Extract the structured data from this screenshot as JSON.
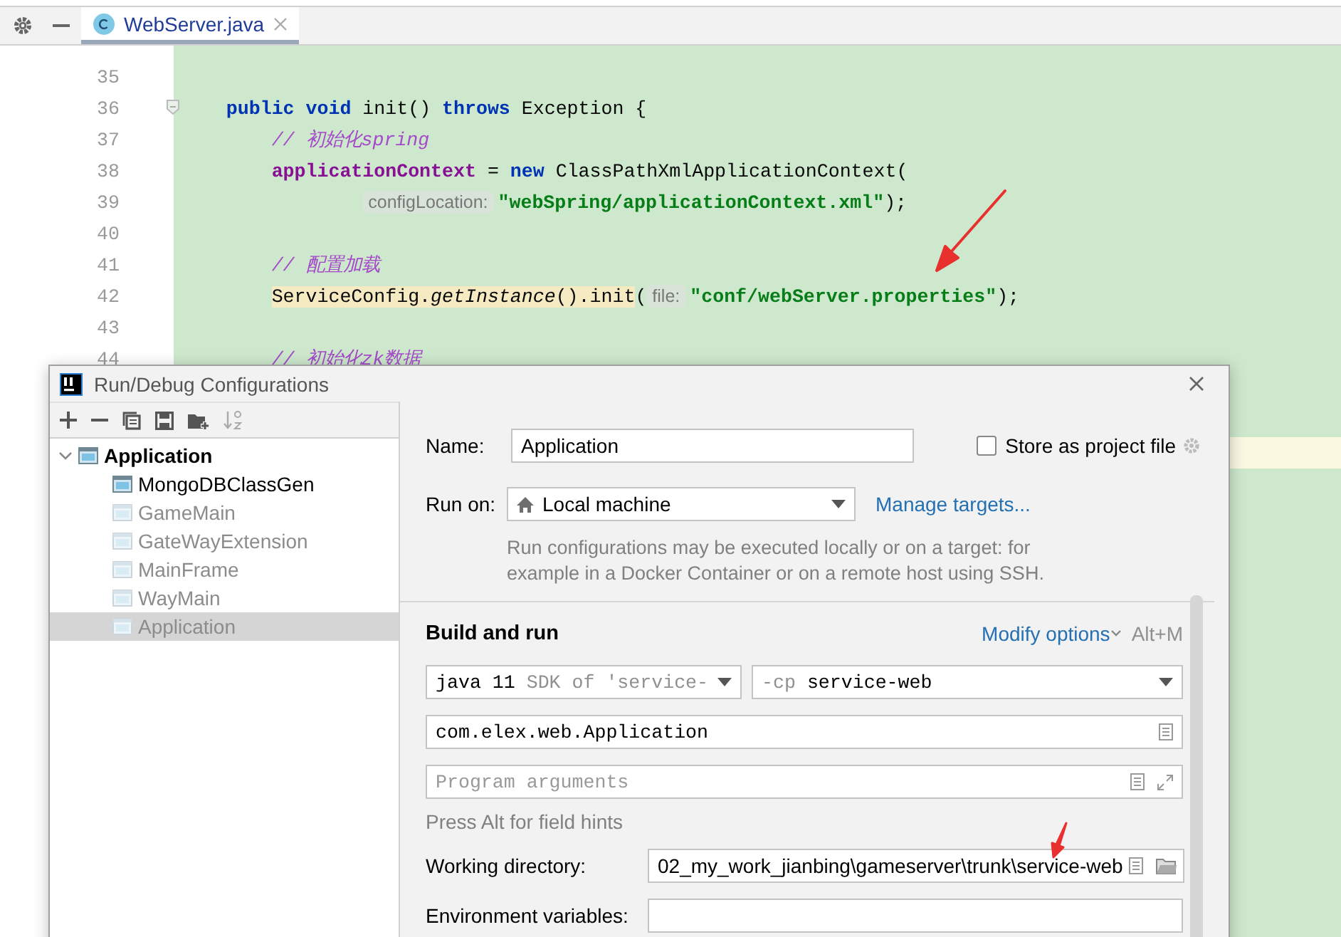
{
  "editor": {
    "tab": {
      "title": "WebServer.java",
      "selected": true
    },
    "lines": [
      {
        "number": "35"
      },
      {
        "number": "36",
        "fold": true,
        "kind": "method",
        "tokens": [
          {
            "kind": "keyword",
            "text": "public "
          },
          {
            "kind": "keyword",
            "text": "void "
          },
          {
            "kind": "plain",
            "text": "init() "
          },
          {
            "kind": "keyword",
            "text": "throws "
          },
          {
            "kind": "plain",
            "text": "Exception {"
          }
        ]
      },
      {
        "number": "37",
        "kind": "statement",
        "tokens": [
          {
            "kind": "comment",
            "text": "// 初始化spring"
          }
        ]
      },
      {
        "number": "38",
        "kind": "statement",
        "tokens": [
          {
            "kind": "field",
            "text": "applicationContext"
          },
          {
            "kind": "plain",
            "text": " = "
          },
          {
            "kind": "keyword",
            "text": "new "
          },
          {
            "kind": "plain",
            "text": "ClassPathXmlApplicationContext("
          }
        ]
      },
      {
        "number": "39",
        "kind": "continuation",
        "tokens": [
          {
            "kind": "hint",
            "text": "configLocation:"
          },
          {
            "kind": "string",
            "text": "\"webSpring/applicationContext.xml\""
          },
          {
            "kind": "plain",
            "text": ");"
          }
        ]
      },
      {
        "number": "40"
      },
      {
        "number": "41",
        "kind": "statement",
        "tokens": [
          {
            "kind": "comment",
            "text": "// 配置加载"
          }
        ]
      },
      {
        "number": "42",
        "kind": "statement",
        "tokens": [
          {
            "kind": "call",
            "text": "ServiceConfig."
          },
          {
            "kind": "call_static",
            "text": "getInstance"
          },
          {
            "kind": "call",
            "text": "().init"
          },
          {
            "kind": "plain",
            "text": "("
          },
          {
            "kind": "hint",
            "text": "file:"
          },
          {
            "kind": "string",
            "text": "\"conf/webServer.properties\""
          },
          {
            "kind": "plain",
            "text": ");"
          }
        ]
      },
      {
        "number": "43"
      },
      {
        "number": "44",
        "kind": "statement",
        "tokens": [
          {
            "kind": "comment",
            "text": "// 初始化zk数据"
          }
        ]
      }
    ]
  },
  "dialog": {
    "title": "Run/Debug Configurations",
    "tree": [
      {
        "label": "Application",
        "expanded": true,
        "selected": false,
        "children": [
          {
            "label": "MongoDBClassGen",
            "temporary": false,
            "selected": false
          },
          {
            "label": "GameMain",
            "temporary": true,
            "selected": false
          },
          {
            "label": "GateWayExtension",
            "temporary": true,
            "selected": false
          },
          {
            "label": "MainFrame",
            "temporary": true,
            "selected": false
          },
          {
            "label": "WayMain",
            "temporary": true,
            "selected": false
          },
          {
            "label": "Application",
            "temporary": true,
            "selected": true
          }
        ]
      }
    ],
    "form": {
      "name": {
        "label": "Name:",
        "value": "Application"
      },
      "store_as_project_file": {
        "label": "Store as project file",
        "checked": false
      },
      "run_on": {
        "label": "Run on:",
        "value": "Local machine",
        "link": "Manage targets...",
        "description": "Run configurations may be executed locally or on a target: for example in a Docker Container or on a remote host using SSH."
      },
      "build_and_run": {
        "title": "Build and run",
        "modify_options": "Modify options",
        "shortcut": "Alt+M",
        "jre": {
          "value": "java 11",
          "hint": "SDK of 'service-"
        },
        "classpath": {
          "prefix": "-cp",
          "value": "service-web"
        },
        "main_class": "com.elex.web.Application",
        "program_arguments": {
          "placeholder": "Program arguments"
        },
        "field_hint": "Press Alt for field hints"
      },
      "working_directory": {
        "label": "Working directory:",
        "value": "02_my_work_jianbing\\gameserver\\trunk\\service-web"
      },
      "environment_variables": {
        "label": "Environment variables:"
      }
    }
  }
}
